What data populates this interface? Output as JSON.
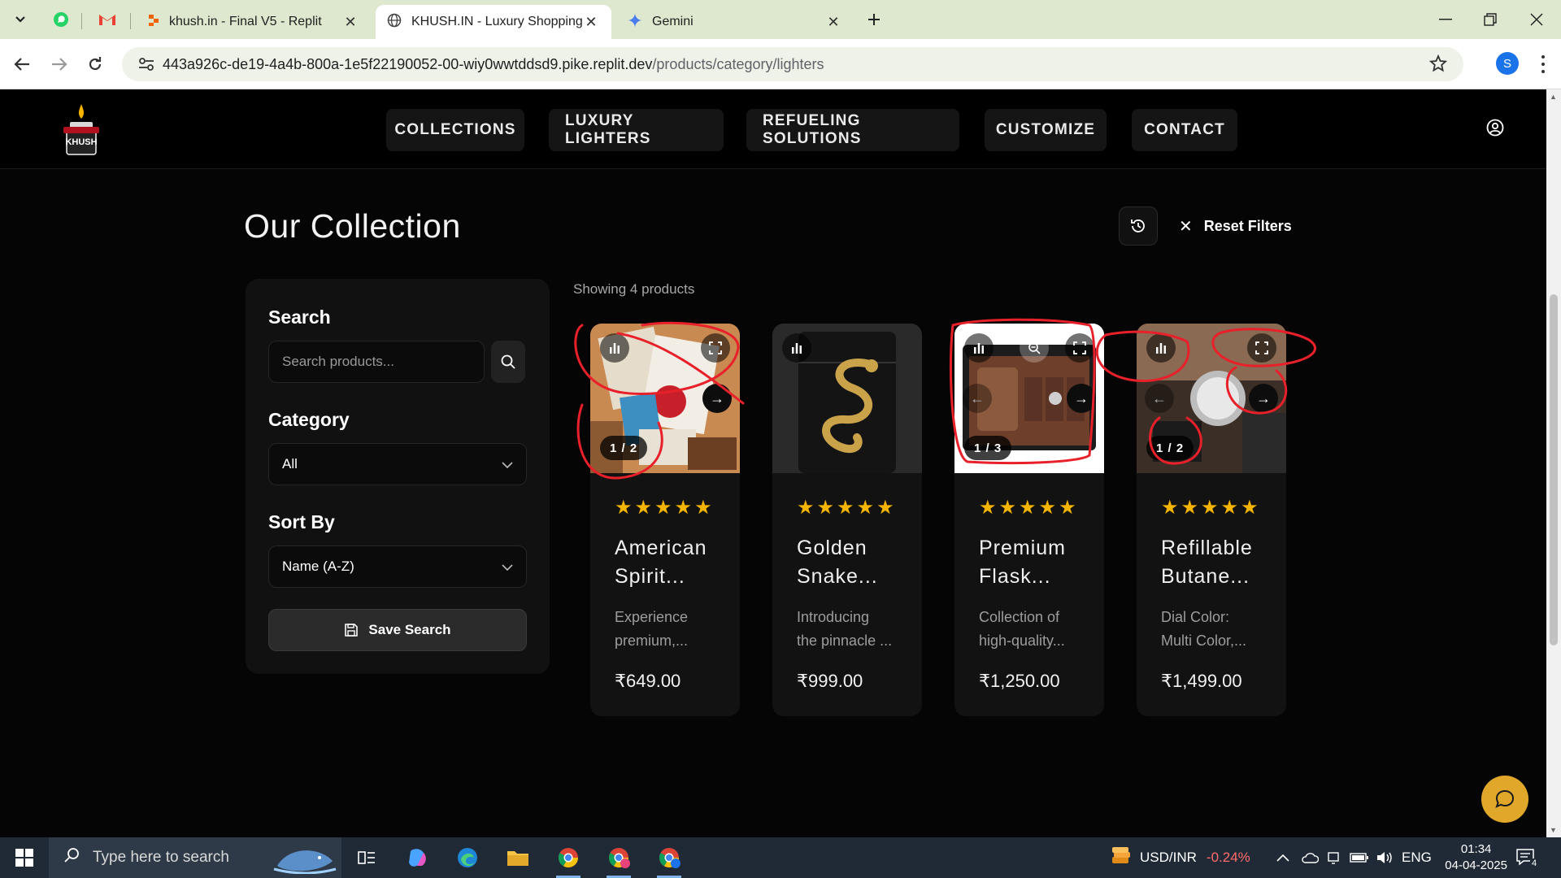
{
  "browser": {
    "tabs": [
      {
        "title": "khush.in - Final V5 - Replit",
        "icon": "replit-icon"
      },
      {
        "title": "KHUSH.IN - Luxury Shopping Ex",
        "icon": "globe-icon"
      },
      {
        "title": "Gemini",
        "icon": "gemini-icon"
      }
    ],
    "url_host": "443a926c-de19-4a4b-800a-1e5f22190052-00-wiy0wwtddsd9.pike.replit.dev",
    "url_path": "/products/category/lighters",
    "profile_initial": "S"
  },
  "site": {
    "logo_text": "KHUSH",
    "nav": [
      "COLLECTIONS",
      "LUXURY LIGHTERS",
      "REFUELING SOLUTIONS",
      "CUSTOMIZE",
      "CONTACT"
    ]
  },
  "page": {
    "title": "Our Collection",
    "reset_label": "Reset Filters",
    "showing": "Showing 4 products"
  },
  "filters": {
    "search_label": "Search",
    "search_placeholder": "Search products...",
    "category_label": "Category",
    "category_value": "All",
    "sort_label": "Sort By",
    "sort_value": "Name (A-Z)",
    "save_label": "Save Search"
  },
  "products": [
    {
      "name_line1": "American",
      "name_line2": "Spirit...",
      "desc_line1": "Experience",
      "desc_line2": "premium,...",
      "price": "₹649.00",
      "counter": "1 / 2",
      "rating": 5
    },
    {
      "name_line1": "Golden",
      "name_line2": "Snake...",
      "desc_line1": "Introducing",
      "desc_line2": "the pinnacle ...",
      "price": "₹999.00",
      "counter": "",
      "rating": 5
    },
    {
      "name_line1": "Premium",
      "name_line2": "Flask...",
      "desc_line1": "Collection of",
      "desc_line2": "high-quality...",
      "price": "₹1,250.00",
      "counter": "1 / 3",
      "rating": 5
    },
    {
      "name_line1": "Refillable",
      "name_line2": "Butane...",
      "desc_line1": "Dial Color:",
      "desc_line2": "Multi Color,...",
      "price": "₹1,499.00",
      "counter": "1 / 2",
      "rating": 5
    }
  ],
  "stars_text": "★★★★★",
  "taskbar": {
    "search_placeholder": "Type here to search",
    "ticker_name": "USD/INR",
    "ticker_change": "-0.24%",
    "language": "ENG",
    "time": "01:34",
    "date": "04-04-2025",
    "notifications": "4"
  },
  "colors": {
    "accent": "#e1a72a",
    "star": "#f5b400",
    "annotation": "#e8202a",
    "ticker_negative": "#ff6b6b"
  }
}
